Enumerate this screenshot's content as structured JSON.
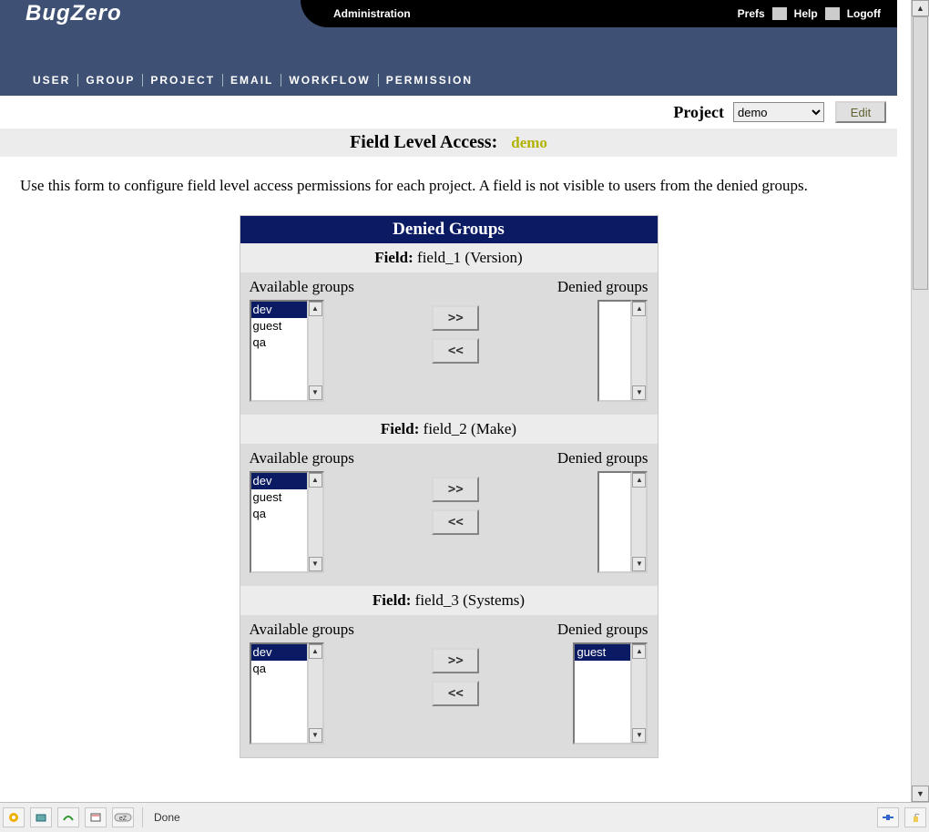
{
  "logo": {
    "part1": "Bug",
    "part2": "Zero"
  },
  "header": {
    "title": "Administration",
    "links": {
      "prefs": "Prefs",
      "help": "Help",
      "logoff": "Logoff"
    }
  },
  "nav": {
    "user": "USER",
    "group": "GROUP",
    "project": "PROJECT",
    "email": "EMAIL",
    "workflow": "WORKFLOW",
    "permission": "PERMISSION"
  },
  "projectrow": {
    "label": "Project",
    "selected": "demo",
    "edit": "Edit"
  },
  "page_title": {
    "label": "Field Level Access:",
    "project": "demo"
  },
  "explain": "Use this form to configure field level access permissions for each project. A field is not visible to users from the denied groups.",
  "section_header": "Denied Groups",
  "labels": {
    "field": "Field:",
    "available": "Available groups",
    "denied": "Denied groups",
    "add": ">>",
    "remove": "<<"
  },
  "fields": [
    {
      "id": "field_1",
      "display": "field_1 (Version)",
      "available": [
        "dev",
        "guest",
        "qa"
      ],
      "available_selected": [
        "dev"
      ],
      "denied": [],
      "denied_selected": []
    },
    {
      "id": "field_2",
      "display": "field_2 (Make)",
      "available": [
        "dev",
        "guest",
        "qa"
      ],
      "available_selected": [
        "dev"
      ],
      "denied": [],
      "denied_selected": []
    },
    {
      "id": "field_3",
      "display": "field_3 (Systems)",
      "available": [
        "dev",
        "qa"
      ],
      "available_selected": [
        "dev"
      ],
      "denied": [
        "guest"
      ],
      "denied_selected": [
        "guest"
      ]
    }
  ],
  "status": {
    "done": "Done"
  }
}
